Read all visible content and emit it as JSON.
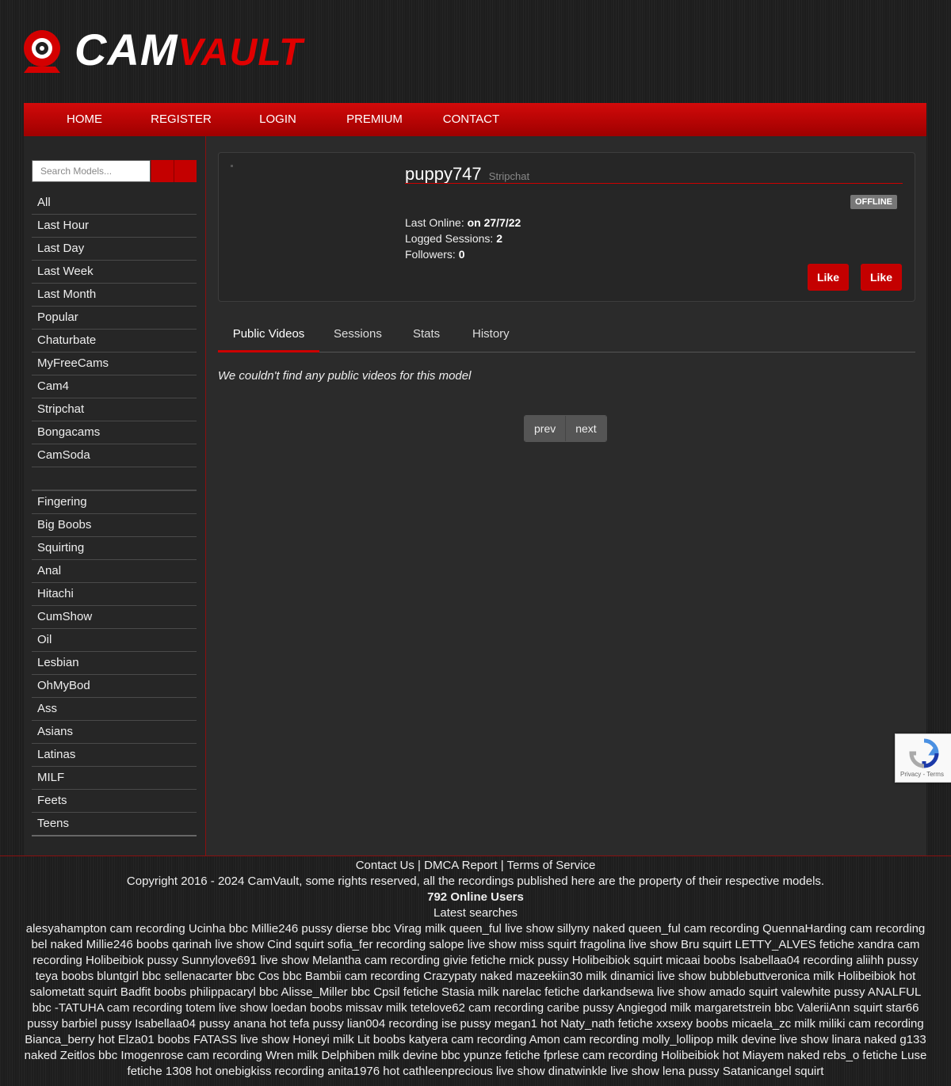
{
  "brand": {
    "name_part1": "CAM",
    "name_part2": "VAULT"
  },
  "nav": [
    "HOME",
    "REGISTER",
    "LOGIN",
    "PREMIUM",
    "CONTACT"
  ],
  "search": {
    "placeholder": "Search Models...",
    "button1": "",
    "button2": ""
  },
  "sidebar": {
    "filters": [
      "All",
      "Last Hour",
      "Last Day",
      "Last Week",
      "Last Month",
      "Popular",
      "Chaturbate",
      "MyFreeCams",
      "Cam4",
      "Stripchat",
      "Bongacams",
      "CamSoda"
    ],
    "categories": [
      "Fingering",
      "Big Boobs",
      "Squirting",
      "Anal",
      "Hitachi",
      "CumShow",
      "Oil",
      "Lesbian",
      "OhMyBod",
      "Ass",
      "Asians",
      "Latinas",
      "MILF",
      "Feets",
      "Teens"
    ]
  },
  "profile": {
    "name_icon": "",
    "name": "puppy747",
    "site": "Stripchat",
    "stars": "",
    "status": "OFFLINE",
    "last_online_label": "Last Online: ",
    "last_online_value": "on 27/7/22",
    "sessions_label": "Logged Sessions: ",
    "sessions_value": "2",
    "followers_label": "Followers: ",
    "followers_value": "0",
    "like_button_1": " Like",
    "like_button_2": " Like"
  },
  "tabs": [
    " Public Videos",
    " Sessions",
    " Stats",
    " History"
  ],
  "content": {
    "empty_message": "We couldn't find any public videos for this model"
  },
  "pager": {
    "prev": "prev",
    "next": "next"
  },
  "footer": {
    "links": "Contact Us | DMCA Report | Terms of Service",
    "copyright": "Copyright 2016 - 2024 CamVault, some rights reserved, all the recordings published here are the property of their respective models.",
    "online_users": "792 Online Users",
    "latest_heading": "Latest searches",
    "latest_searches": "alesyahampton cam recording Ucinha bbc Millie246 pussy dierse bbc Virag milk queen_ful live show sillyny naked queen_ful cam recording QuennaHarding cam recording bel naked Millie246 boobs qarinah live show Cind squirt sofia_fer recording salope live show miss squirt fragolina live show Bru squirt LETTY_ALVES fetiche xandra cam recording Holibeibiok pussy Sunnylove691 live show Melantha cam recording givie fetiche rnick pussy Holibeibiok squirt micaai boobs Isabellaa04 recording aliihh pussy teya boobs bluntgirl bbc sellenacarter bbc Cos bbc Bambii cam recording Crazypaty naked mazeekiin30 milk dinamici live show bubblebuttveronica milk Holibeibiok hot salometatt squirt Badfit boobs philippacaryl bbc Alisse_Miller bbc Cpsil fetiche Stasia milk narelac fetiche darkandsewa live show amado squirt valewhite pussy ANALFUL bbc -TATUHA cam recording totem live show loedan boobs missav milk tetelove62 cam recording caribe pussy Angiegod milk margaretstrein bbc ValeriiAnn squirt star66 pussy barbiel pussy Isabellaa04 pussy anana hot tefa pussy lian004 recording ise pussy megan1 hot Naty_nath fetiche xxsexy boobs micaela_zc milk miliki cam recording Bianca_berry hot Elza01 boobs FATASS live show Honeyi milk Lit boobs katyera cam recording Amon cam recording molly_lollipop milk devine live show linara naked g133 naked Zeitlos bbc Imogenrose cam recording Wren milk Delphiben milk devine bbc ypunze fetiche fprlese cam recording Holibeibiok hot Miayem naked rebs_o fetiche Luse fetiche 1308 hot onebigkiss recording anita1976 hot cathleenprecious live show dinatwinkle live show lena pussy Satanicangel squirt"
  },
  "recaptcha": {
    "label": "Privacy - Terms"
  },
  "colors": {
    "accent": "#c40000",
    "star": "#ffd700",
    "background": "#1d1d1d"
  }
}
